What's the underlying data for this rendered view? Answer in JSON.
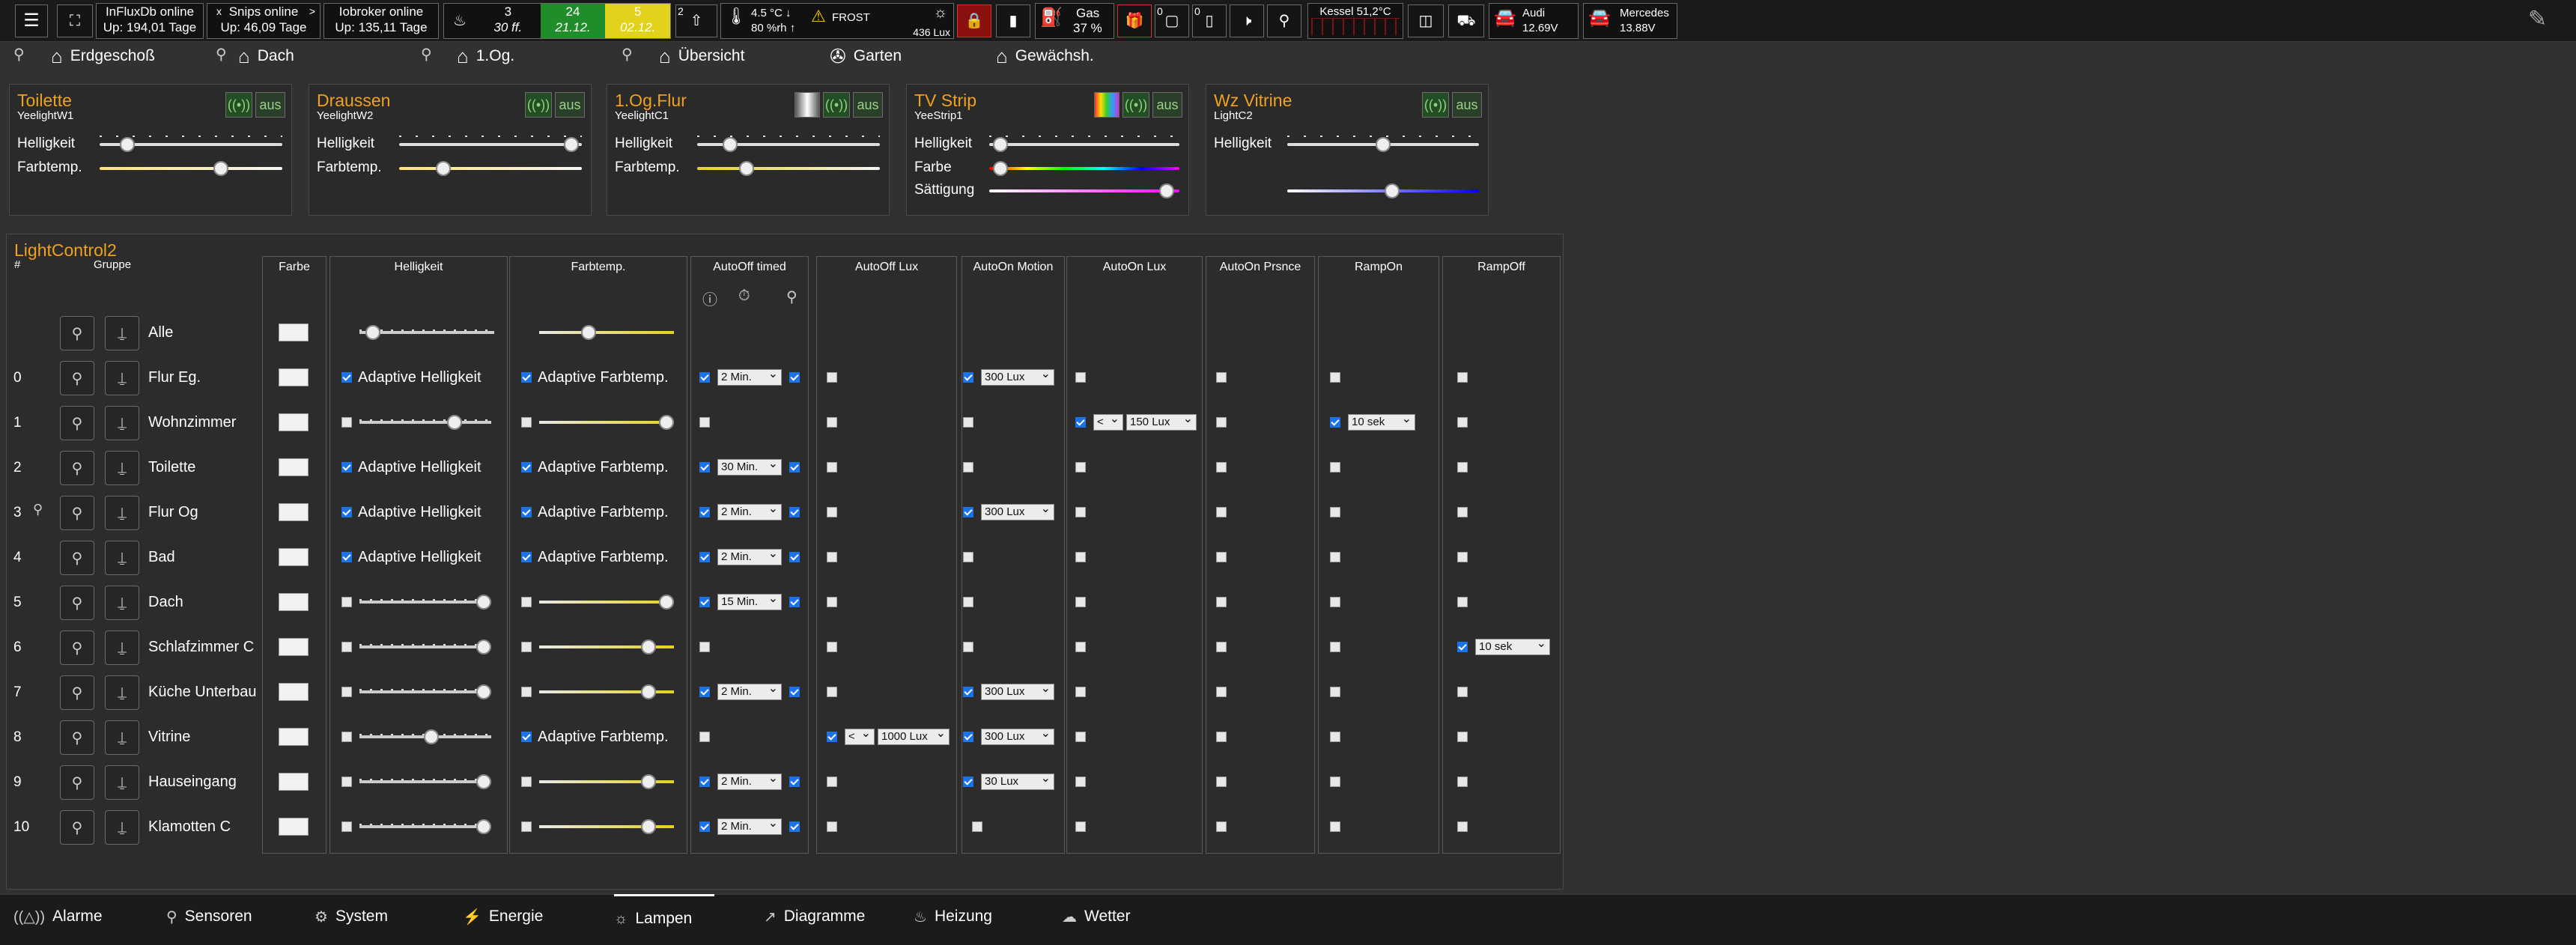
{
  "topbar": {
    "menu_icon": "menu-icon",
    "fullscreen_icon": "fullscreen-icon",
    "influx": {
      "line1": "InFluxDb online",
      "line2": "Up: 194,01 Tage"
    },
    "snips": {
      "line1": "Snips online",
      "line2": "Up: 46,09 Tage",
      "left_mark": "x",
      "right_mark": ">"
    },
    "iobroker": {
      "line1": "Iobroker online",
      "line2": "Up: 135,11 Tage"
    },
    "heating": {
      "a1": "3",
      "a2": "30 ff.",
      "b1": "24",
      "b2": "21.12.",
      "c1": "5",
      "c2": "02.12."
    },
    "counter_badge": "2",
    "weather": {
      "temp": "4.5 °C ↓",
      "hum": "80 %rh ↑"
    },
    "frost": {
      "label": "FROST",
      "lux": "436 Lux"
    },
    "gas": {
      "label": "Gas",
      "value": "37 %"
    },
    "small_badges": [
      "0",
      "0"
    ],
    "kessel": {
      "label": "Kessel 51,2°C"
    },
    "audi": {
      "label": "Audi",
      "value": "12.69V"
    },
    "mercedes": {
      "label": "Mercedes",
      "value": "13.88V"
    }
  },
  "rooms": [
    "Erdgeschoß",
    "Dach",
    "1.Og.",
    "Übersicht",
    "Garten",
    "Gewächsh."
  ],
  "cards": [
    {
      "title": "Toilette",
      "subtitle": "YeelightW1",
      "off": "aus",
      "labels": [
        "Helligkeit",
        "Farbtemp."
      ],
      "levels": [
        0.12,
        0.68
      ]
    },
    {
      "title": "Draussen",
      "subtitle": "YeelightW2",
      "off": "aus",
      "labels": [
        "Helligkeit",
        "Farbtemp."
      ],
      "levels": [
        0.98,
        0.22
      ]
    },
    {
      "title": "1.Og.Flur",
      "subtitle": "YeelightC1",
      "off": "aus",
      "labels": [
        "Helligkeit",
        "Farbtemp."
      ],
      "levels": [
        0.15,
        0.25
      ]
    },
    {
      "title": "TV Strip",
      "subtitle": "YeeStrip1",
      "off": "aus",
      "labels": [
        "Helligkeit",
        "Farbe",
        "Sättigung"
      ],
      "levels": [
        0.02,
        0.02,
        0.97
      ]
    },
    {
      "title": "Wz Vitrine",
      "subtitle": "LightC2",
      "off": "aus",
      "labels": [
        "Helligkeit"
      ],
      "levels": [
        0.5,
        0.55
      ]
    }
  ],
  "lightcontrol": {
    "title": "LightControl2",
    "hash": "#",
    "gruppe": "Gruppe",
    "columns": [
      "Farbe",
      "Helligkeit",
      "Farbtemp.",
      "AutoOff timed",
      "AutoOff Lux",
      "AutoOn Motion",
      "AutoOn Lux",
      "AutoOn Prsnce",
      "RampOn",
      "RampOff"
    ],
    "rows": [
      {
        "num": "",
        "name": "Alle",
        "bright": 0.05,
        "ct": 0.35
      },
      {
        "num": "0",
        "name": "Flur Eg.",
        "bright_text": "Adaptive Helligkeit",
        "ct_text": "Adaptive Farbtemp.",
        "timed": "2 Min.",
        "motion": "300 Lux"
      },
      {
        "num": "1",
        "name": "Wohnzimmer",
        "bright": 0.75,
        "ct": 1.0,
        "lux_op": "<",
        "lux_val": "150 Lux",
        "rampon": "10 sek"
      },
      {
        "num": "2",
        "name": "Toilette",
        "bright_text": "Adaptive Helligkeit",
        "ct_text": "Adaptive Farbtemp.",
        "timed": "30 Min."
      },
      {
        "num": "3",
        "name": "Flur Og",
        "bright_text": "Adaptive Helligkeit",
        "ct_text": "Adaptive Farbtemp.",
        "timed": "2 Min.",
        "motion": "300 Lux"
      },
      {
        "num": "4",
        "name": "Bad",
        "bright_text": "Adaptive Helligkeit",
        "ct_text": "Adaptive Farbtemp.",
        "timed": "2 Min."
      },
      {
        "num": "5",
        "name": "Dach",
        "bright": 1.0,
        "ct": 1.0,
        "timed": "15 Min."
      },
      {
        "num": "6",
        "name": "Schlafzimmer C",
        "bright": 1.0,
        "ct": 0.85,
        "rampoff": "10 sek"
      },
      {
        "num": "7",
        "name": "Küche Unterbau",
        "bright": 1.0,
        "ct": 0.85,
        "timed": "2 Min.",
        "motion": "300 Lux"
      },
      {
        "num": "8",
        "name": "Vitrine",
        "bright": 0.55,
        "ct_text": "Adaptive Farbtemp.",
        "offlux_op": "<",
        "offlux_val": "1000 Lux",
        "motion": "300 Lux"
      },
      {
        "num": "9",
        "name": "Hauseingang",
        "bright": 1.0,
        "ct": 0.85,
        "timed": "2 Min.",
        "motion": "30 Lux"
      },
      {
        "num": "10",
        "name": "Klamotten C",
        "bright": 1.0,
        "ct": 0.85,
        "timed": "2 Min."
      }
    ]
  },
  "nav": [
    "Alarme",
    "Sensoren",
    "System",
    "Energie",
    "Lampen",
    "Diagramme",
    "Heizung",
    "Wetter"
  ],
  "nav_active": "Lampen",
  "colors": {
    "accent": "#f0a11e",
    "background": "#313131",
    "bar": "#1a1a1a",
    "check": "#1a73e8"
  }
}
